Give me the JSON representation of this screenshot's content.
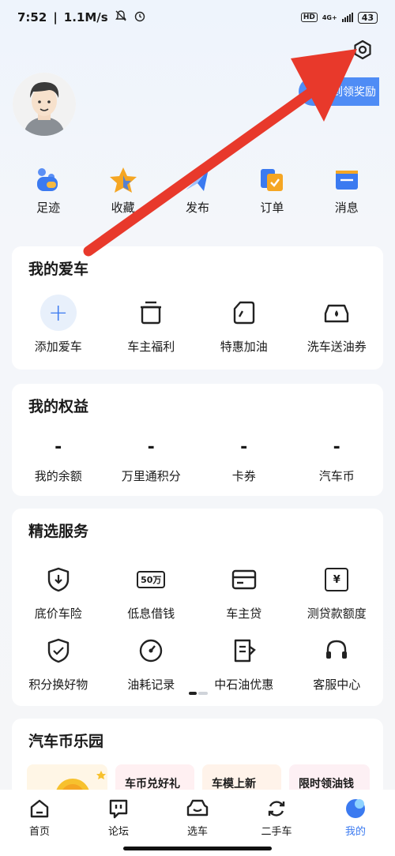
{
  "status_bar": {
    "time": "7:52",
    "speed": "1.1M/s",
    "hd": "HD",
    "net": "4G+",
    "battery": "43"
  },
  "header": {
    "signin_label": "签到领奖励"
  },
  "quick_actions": [
    {
      "label": "足迹",
      "icon": "footprint-icon"
    },
    {
      "label": "收藏",
      "icon": "star-icon"
    },
    {
      "label": "发布",
      "icon": "paper-plane-icon"
    },
    {
      "label": "订单",
      "icon": "order-icon"
    },
    {
      "label": "消息",
      "icon": "message-icon"
    }
  ],
  "my_car": {
    "title": "我的爱车",
    "items": [
      {
        "label": "添加爱车",
        "icon": "plus-icon"
      },
      {
        "label": "车主福利",
        "icon": "gift-box-icon"
      },
      {
        "label": "特惠加油",
        "icon": "fuel-can-icon"
      },
      {
        "label": "洗车送油券",
        "icon": "car-wash-icon"
      }
    ]
  },
  "benefits": {
    "title": "我的权益",
    "items": [
      {
        "value": "-",
        "label": "我的余额"
      },
      {
        "value": "-",
        "label": "万里通积分"
      },
      {
        "value": "-",
        "label": "卡券"
      },
      {
        "value": "-",
        "label": "汽车币"
      }
    ]
  },
  "services": {
    "title": "精选服务",
    "row1": [
      {
        "label": "底价车险",
        "icon": "shield-down-icon"
      },
      {
        "label": "低息借钱",
        "icon": "50-wan-icon",
        "badge": "50万"
      },
      {
        "label": "车主贷",
        "icon": "card-icon"
      },
      {
        "label": "测贷款额度",
        "icon": "calendar-yuan-icon",
        "badge": "¥"
      }
    ],
    "row2": [
      {
        "label": "积分换好物",
        "icon": "shield-check-icon"
      },
      {
        "label": "油耗记录",
        "icon": "gauge-icon"
      },
      {
        "label": "中石油优惠",
        "icon": "receipt-icon"
      },
      {
        "label": "客服中心",
        "icon": "headset-icon"
      }
    ]
  },
  "park": {
    "title": "汽车币乐园",
    "pills": [
      "车币兑好礼",
      "车模上新",
      "限时领油钱"
    ]
  },
  "tabs": [
    {
      "label": "首页",
      "icon": "home-icon"
    },
    {
      "label": "论坛",
      "icon": "forum-icon"
    },
    {
      "label": "选车",
      "icon": "car-icon"
    },
    {
      "label": "二手车",
      "icon": "recycle-icon"
    },
    {
      "label": "我的",
      "icon": "profile-icon"
    }
  ],
  "colors": {
    "accent": "#3b7af0",
    "arrow": "#e8392b",
    "card_bg": "#ffffff"
  }
}
